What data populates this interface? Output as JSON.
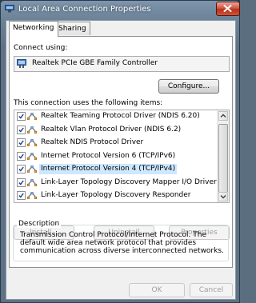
{
  "window": {
    "title": "Local Area Connection Properties",
    "icon": "network-adapter-icon"
  },
  "tabs": [
    {
      "label": "Networking",
      "active": true
    },
    {
      "label": "Sharing",
      "active": false
    }
  ],
  "connect_using": {
    "label": "Connect using:",
    "adapter_name": "Realtek PCIe GBE Family Controller"
  },
  "configure_button": "Configure...",
  "items_section": {
    "label": "This connection uses the following items:",
    "items": [
      {
        "label": "Realtek Teaming Protocol Driver (NDIS 6.20)",
        "checked": true,
        "selected": false
      },
      {
        "label": "Realtek Vlan Protocol Driver (NDIS 6.2)",
        "checked": true,
        "selected": false
      },
      {
        "label": "Realtek NDIS Protocol Driver",
        "checked": true,
        "selected": false
      },
      {
        "label": "Internet Protocol Version 6 (TCP/IPv6)",
        "checked": true,
        "selected": false
      },
      {
        "label": "Internet Protocol Version 4 (TCP/IPv4)",
        "checked": true,
        "selected": true
      },
      {
        "label": "Link-Layer Topology Discovery Mapper I/O Driver",
        "checked": true,
        "selected": false
      },
      {
        "label": "Link-Layer Topology Discovery Responder",
        "checked": true,
        "selected": false
      }
    ]
  },
  "action_buttons": {
    "install": "Install...",
    "uninstall": "Uninstall",
    "properties": "Properties"
  },
  "description": {
    "legend": "Description",
    "text": "Transmission Control Protocol/Internet Protocol. The default wide area network protocol that provides communication across diverse interconnected networks."
  },
  "dialog_buttons": {
    "ok": "OK",
    "cancel": "Cancel"
  },
  "colors": {
    "selection": "#cde8ff",
    "close_button": "#c8452e",
    "frame": "#6c8398"
  }
}
